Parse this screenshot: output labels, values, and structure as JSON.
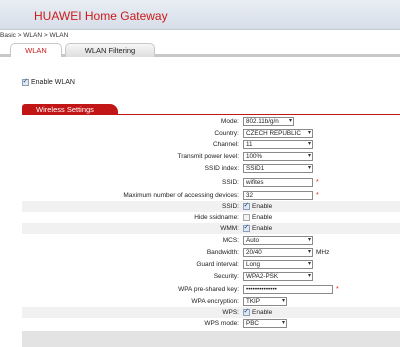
{
  "header": {
    "title": "HUAWEI Home Gateway"
  },
  "breadcrumb": "Basic > WLAN > WLAN",
  "tabs": {
    "wlan": "WLAN",
    "filter": "WLAN Filtering"
  },
  "enable_wlan": {
    "label": "Enable WLAN",
    "checked": true
  },
  "section_title": "Wireless Settings",
  "fields": {
    "mode": {
      "label": "Mode:",
      "value": "802.11b/g/n"
    },
    "country": {
      "label": "Country:",
      "value": "CZECH REPUBLIC"
    },
    "channel": {
      "label": "Channel:",
      "value": "11"
    },
    "tx_power": {
      "label": "Transmit power level:",
      "value": "100%"
    },
    "ssid_index": {
      "label": "SSID index:",
      "value": "SSID1"
    },
    "ssid": {
      "label": "SSID:",
      "value": "wifites"
    },
    "max_devices": {
      "label": "Maximum number of accessing devices:",
      "value": "32"
    },
    "ssid_enable": {
      "label": "SSID:",
      "text": "Enable",
      "checked": true
    },
    "hide_ssid": {
      "label": "Hide ssidname:",
      "text": "Enable",
      "checked": false
    },
    "wmm": {
      "label": "WMM:",
      "text": "Enable",
      "checked": true
    },
    "mcs": {
      "label": "MCS:",
      "value": "Auto"
    },
    "bandwidth": {
      "label": "Bandwidth:",
      "value": "20/40",
      "unit": "MHz"
    },
    "guard_interval": {
      "label": "Guard interval:",
      "value": "Long"
    },
    "security": {
      "label": "Security:",
      "value": "WPA2-PSK"
    },
    "wpa_key": {
      "label": "WPA pre-shared key:",
      "value": "••••••••••••••"
    },
    "wpa_encryption": {
      "label": "WPA encryption:",
      "value": "TKIP"
    },
    "wps": {
      "label": "WPS:",
      "text": "Enable",
      "checked": true
    },
    "wps_mode": {
      "label": "WPS mode:",
      "value": "PBC"
    }
  },
  "required_mark": "*",
  "colors": {
    "brand": "#cc1a1a",
    "section": "#c21515"
  }
}
